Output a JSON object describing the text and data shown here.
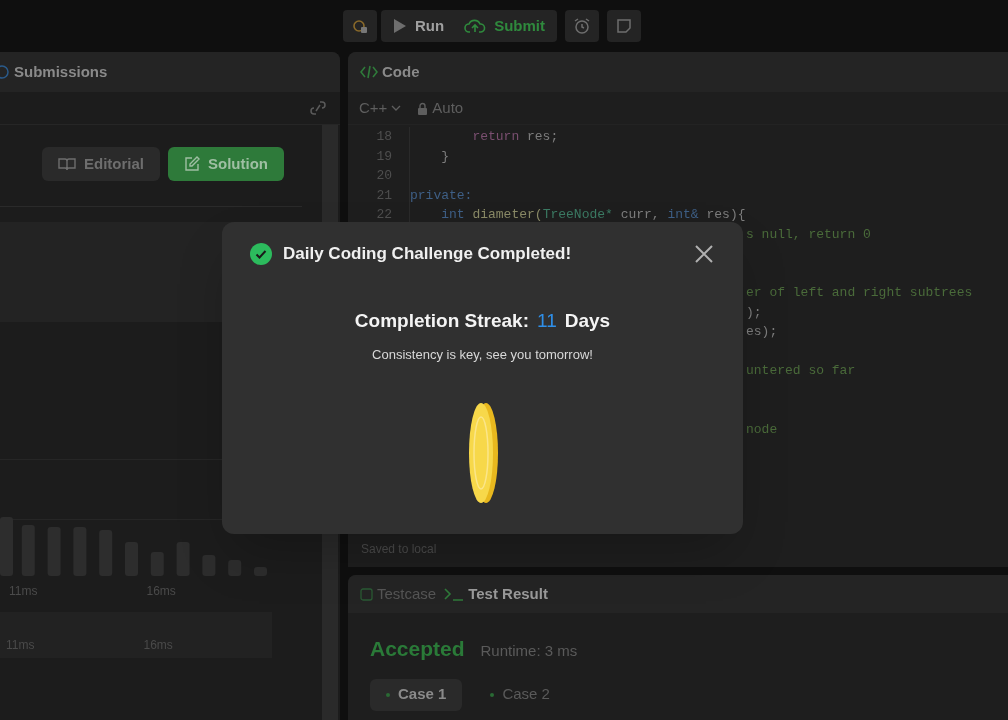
{
  "toolbar": {
    "items": [
      {
        "kind": "bug"
      },
      {
        "kind": "run",
        "label": "Run"
      },
      {
        "kind": "submit",
        "label": "Submit"
      },
      {
        "kind": "alarm"
      },
      {
        "kind": "note"
      }
    ]
  },
  "left_panel": {
    "tab": "Submissions",
    "buttons": [
      {
        "kind": "editorial",
        "label": "Editorial"
      },
      {
        "kind": "solution",
        "label": "Solution"
      }
    ],
    "runtime_axis": [
      "11ms",
      "16ms"
    ],
    "memory_axis": [
      "11ms",
      "16ms"
    ]
  },
  "code_panel": {
    "title": "Code",
    "language": "C++",
    "mode": "Auto",
    "status": "Saved to local",
    "lines": [
      {
        "kind": "full",
        "number": "18",
        "segments": [
          {
            "kind": "keyword2",
            "text": "        return"
          },
          {
            "kind": "plain",
            "text": " res;"
          }
        ]
      },
      {
        "kind": "full",
        "number": "19",
        "segments": [
          {
            "kind": "plain",
            "text": "    }"
          }
        ]
      },
      {
        "kind": "full",
        "number": "20"
      },
      {
        "kind": "full",
        "number": "21",
        "segments": [
          {
            "kind": "keyword",
            "text": "private:"
          }
        ]
      },
      {
        "kind": "full",
        "number": "22",
        "segments": [
          {
            "kind": "keyword",
            "text": "    int"
          },
          {
            "kind": "func",
            "text": " diameter("
          },
          {
            "kind": "type",
            "text": "TreeNode*"
          },
          {
            "kind": "plain",
            "text": " curr, "
          },
          {
            "kind": "keyword",
            "text": "int&"
          },
          {
            "kind": "plain",
            "text": " res){"
          }
        ]
      },
      {
        "kind": "partial",
        "segments": [
          {
            "kind": "comment",
            "text": "s null, return 0"
          }
        ]
      },
      {
        "kind": "partial"
      },
      {
        "kind": "partial"
      },
      {
        "kind": "partial",
        "segments": [
          {
            "kind": "comment",
            "text": "er of left and right subtrees"
          }
        ]
      },
      {
        "kind": "partial",
        "segments": [
          {
            "kind": "plain",
            "text": ");"
          }
        ]
      },
      {
        "kind": "partial",
        "segments": [
          {
            "kind": "plain",
            "text": "es);"
          }
        ]
      },
      {
        "kind": "partial"
      },
      {
        "kind": "partial",
        "segments": [
          {
            "kind": "comment",
            "text": "untered so far"
          }
        ]
      },
      {
        "kind": "partial"
      },
      {
        "kind": "partial"
      },
      {
        "kind": "partial",
        "segments": [
          {
            "kind": "comment",
            "text": "node"
          }
        ]
      }
    ]
  },
  "test_panel": {
    "tabs": [
      {
        "kind": "testcase",
        "label": "Testcase",
        "selected": false
      },
      {
        "kind": "result",
        "label": "Test Result",
        "selected": true
      }
    ],
    "verdict": "Accepted",
    "runtime": "Runtime: 3 ms",
    "cases": [
      {
        "label": "Case 1",
        "selected": true
      },
      {
        "label": "Case 2",
        "selected": false
      }
    ]
  },
  "modal": {
    "title": "Daily Coding Challenge Completed!",
    "streak_label": "Completion Streak:",
    "streak_value": "11",
    "streak_unit": "Days",
    "message": "Consistency is key, see you tomorrow!"
  }
}
